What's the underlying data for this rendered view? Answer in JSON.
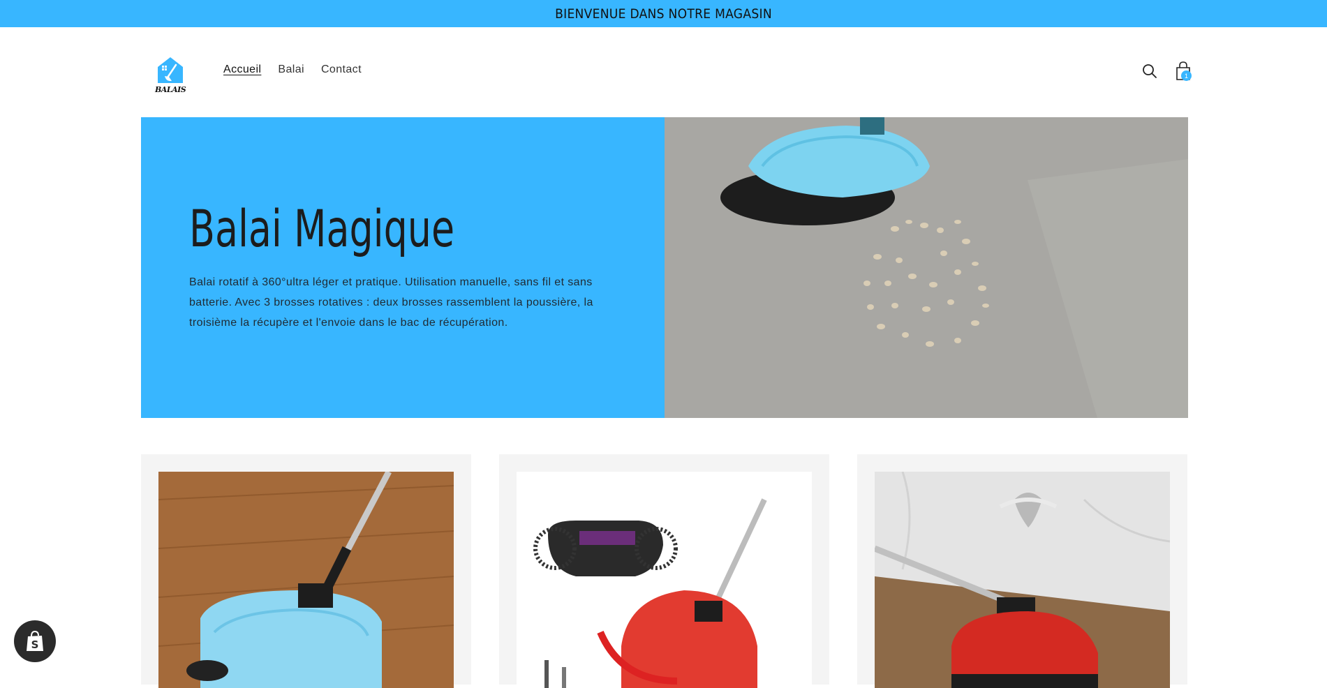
{
  "announcement": {
    "text": "BIENVENUE DANS NOTRE MAGASIN"
  },
  "brand": {
    "logo_text": "BALAIS",
    "logo_icon": "house-broom-logo"
  },
  "nav": {
    "items": [
      {
        "label": "Accueil",
        "active": true
      },
      {
        "label": "Balai",
        "active": false
      },
      {
        "label": "Contact",
        "active": false
      }
    ]
  },
  "header": {
    "search_icon": "search-icon",
    "cart_icon": "shopping-bag-icon",
    "cart_count": "1"
  },
  "hero": {
    "title": "Balai Magique",
    "description": "Balai rotatif à 360°ultra léger et pratique.   Utilisation manuelle, sans fil et sans batterie.   Avec 3 brosses rotatives : deux brosses rassemblent la poussière, la troisième la récupère et l'envoie dans le bac de récupération.",
    "image": "blue-sweeper-on-floor-photo"
  },
  "products": [
    {
      "image": "blue-sweeper-wood-floor-photo"
    },
    {
      "image": "red-sweeper-with-diagram-photo"
    },
    {
      "image": "red-sweeper-under-cabinet-photo"
    }
  ],
  "colors": {
    "accent": "#38b6ff",
    "card_bg": "#f4f4f4",
    "badge": "#2b2b2b"
  }
}
